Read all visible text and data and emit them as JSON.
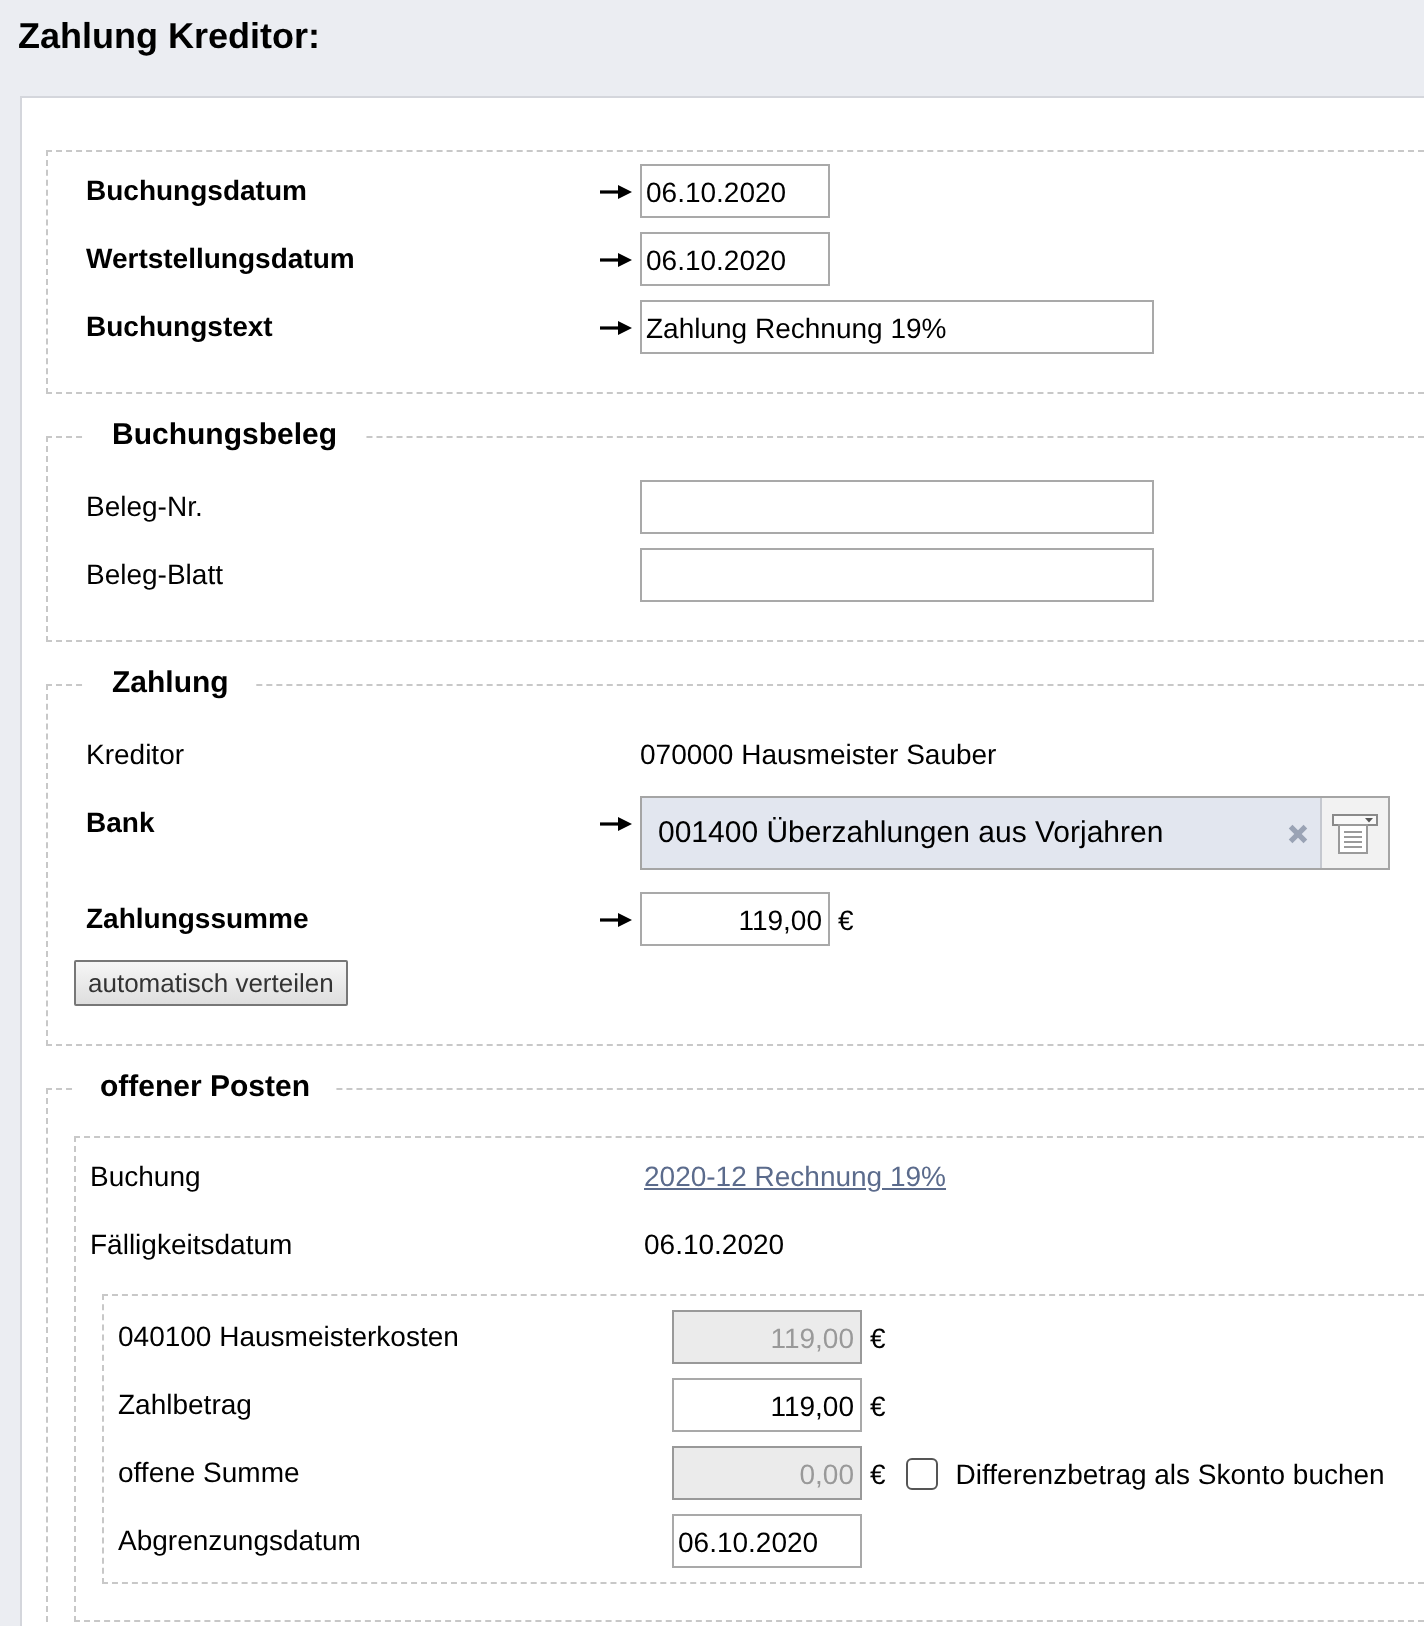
{
  "title": "Zahlung Kreditor:",
  "sections": [
    {
      "rows": [
        {
          "kind": "short",
          "label": "Buchungsdatum",
          "required": true,
          "value": "06.10.2020"
        },
        {
          "kind": "short",
          "label": "Wertstellungsdatum",
          "required": true,
          "value": "06.10.2020"
        },
        {
          "kind": "wide",
          "label": "Buchungstext",
          "required": true,
          "value": "Zahlung Rechnung 19%"
        }
      ]
    },
    {
      "legend": "Buchungsbeleg",
      "rows": [
        {
          "kind": "wide",
          "label": "Beleg-Nr.",
          "required": false
        },
        {
          "kind": "wide",
          "label": "Beleg-Blatt",
          "required": false
        }
      ]
    },
    {
      "legend": "Zahlung",
      "rows": [
        {
          "kind": "text",
          "label": "Kreditor",
          "required": false,
          "value": "070000 Hausmeister Sauber"
        },
        {
          "kind": "combo",
          "label": "Bank",
          "required": true,
          "value": "001400 Überzahlungen aus Vorjahren"
        },
        {
          "kind": "amount",
          "label": "Zahlungssumme",
          "required": true,
          "value": "119,00",
          "unit": "€"
        }
      ],
      "button": "automatisch verteilen"
    },
    {
      "legend": "offener Posten",
      "items": [
        {
          "rows": [
            {
              "kind": "link",
              "label": "Buchung",
              "required": false,
              "value": "2020-12 Rechnung 19%"
            },
            {
              "kind": "text",
              "label": "Fälligkeitsdatum",
              "required": false,
              "value": "06.10.2020"
            }
          ],
          "allocations": [
            {
              "rows": [
                {
                  "kind": "amount",
                  "label": "040100 Hausmeisterkosten",
                  "required": false,
                  "value": "119,00",
                  "unit": "€",
                  "disabled": true
                },
                {
                  "kind": "amount",
                  "label": "Zahlbetrag",
                  "required": false,
                  "value": "119,00",
                  "unit": "€",
                  "disabled": false
                },
                {
                  "kind": "amount",
                  "label": "offene Summe",
                  "required": false,
                  "value": "0,00",
                  "unit": "€",
                  "disabled": true,
                  "checkbox": {
                    "label": "Differenzbetrag als Skonto buchen",
                    "checked": false
                  }
                },
                {
                  "kind": "short",
                  "label": "Abgrenzungsdatum",
                  "required": false,
                  "value": "06.10.2020",
                  "disabled": false
                }
              ]
            }
          ]
        }
      ]
    }
  ]
}
